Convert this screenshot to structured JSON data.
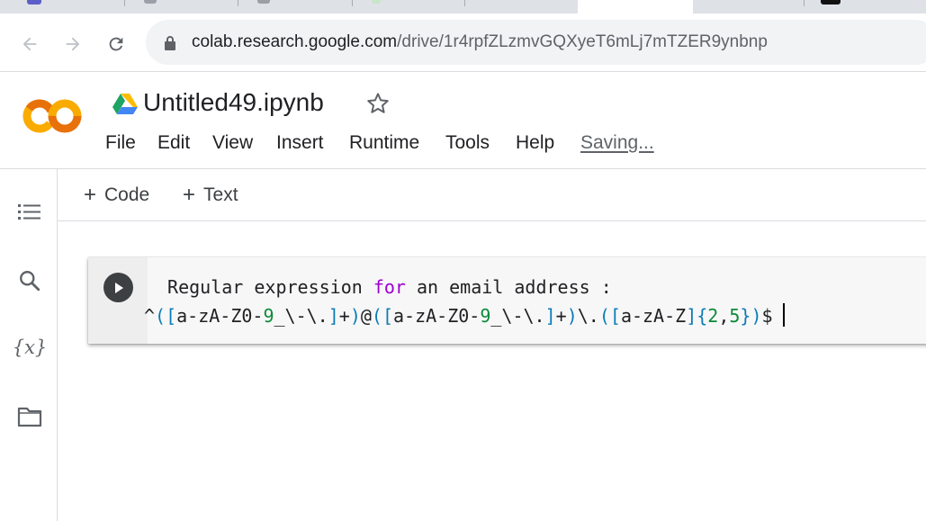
{
  "browser": {
    "url_host": "colab.research.google.com",
    "url_path": "/drive/1r4rpfZLzmvGQXyeT6mLj7mTZER9ynbnp"
  },
  "notebook": {
    "title": "Untitled49.ipynb",
    "menu": [
      "File",
      "Edit",
      "View",
      "Insert",
      "Runtime",
      "Tools",
      "Help"
    ],
    "status": "Saving..."
  },
  "cell_toolbar": {
    "add_code_label": "Code",
    "add_text_label": "Text",
    "plus": "+"
  },
  "cell": {
    "line1_prefix": " Regular expression ",
    "line1_keyword": "for",
    "line1_suffix": " an email address :",
    "line2_tokens": [
      {
        "t": "^",
        "c": "op"
      },
      {
        "t": "(",
        "c": "br"
      },
      {
        "t": "[",
        "c": "br"
      },
      {
        "t": "a-zA-Z0-",
        "c": "op"
      },
      {
        "t": "9",
        "c": "num"
      },
      {
        "t": "_\\-\\.",
        "c": "op"
      },
      {
        "t": "]",
        "c": "br"
      },
      {
        "t": "+",
        "c": "op"
      },
      {
        "t": ")",
        "c": "br"
      },
      {
        "t": "@",
        "c": "op"
      },
      {
        "t": "(",
        "c": "br"
      },
      {
        "t": "[",
        "c": "br"
      },
      {
        "t": "a-zA-Z0-",
        "c": "op"
      },
      {
        "t": "9",
        "c": "num"
      },
      {
        "t": "_\\-\\.",
        "c": "op"
      },
      {
        "t": "]",
        "c": "br"
      },
      {
        "t": "+",
        "c": "op"
      },
      {
        "t": ")",
        "c": "br"
      },
      {
        "t": "\\.",
        "c": "op"
      },
      {
        "t": "(",
        "c": "br"
      },
      {
        "t": "[",
        "c": "br"
      },
      {
        "t": "a-zA-Z",
        "c": "op"
      },
      {
        "t": "]",
        "c": "br"
      },
      {
        "t": "{",
        "c": "br"
      },
      {
        "t": "2",
        "c": "num"
      },
      {
        "t": ",",
        "c": "op"
      },
      {
        "t": "5",
        "c": "num"
      },
      {
        "t": "}",
        "c": "br"
      },
      {
        "t": ")",
        "c": "br"
      },
      {
        "t": "$",
        "c": "op"
      }
    ]
  },
  "sidebar_icons": [
    "table-of-contents-icon",
    "search-icon",
    "variables-icon",
    "files-icon"
  ],
  "sidebar_variables_glyph": "{x}",
  "colors": {
    "colab_orange": "#f9ab00",
    "colab_orange_dark": "#e8710a",
    "keyword": "#9c00d1",
    "bracket": "#0b7bb7",
    "number": "#0b8a3a"
  }
}
